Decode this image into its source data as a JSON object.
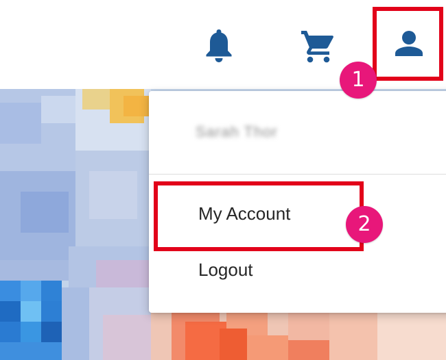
{
  "header": {
    "icons": [
      "bell-icon",
      "cart-icon",
      "user-icon"
    ],
    "icon_color": "#1e5a96"
  },
  "dropdown": {
    "user_name": "Sarah Thor",
    "items": [
      {
        "label": "My Account"
      },
      {
        "label": "Logout"
      }
    ]
  },
  "annotations": {
    "badges": [
      "1",
      "2"
    ],
    "highlight_color": "#e2021a",
    "badge_color": "#e8177a"
  }
}
